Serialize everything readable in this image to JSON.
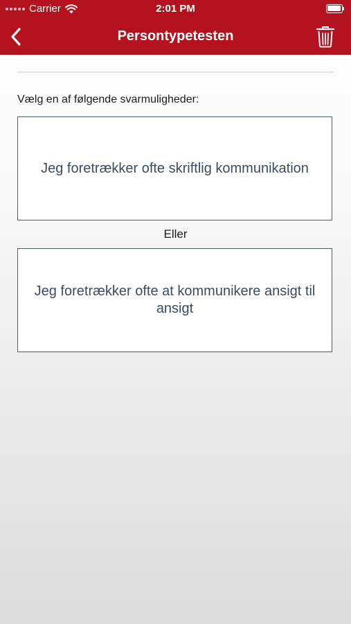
{
  "status_bar": {
    "carrier": "Carrier",
    "time": "2:01 PM"
  },
  "nav": {
    "title": "Persontypetesten",
    "back_icon": "chevron-left-icon",
    "trash_icon": "trash-icon"
  },
  "content": {
    "prompt": "Vælg en af følgende svarmuligheder:",
    "option_1": "Jeg foretrækker ofte skriftlig kommunikation",
    "or_label": "Eller",
    "option_2": "Jeg foretrækker ofte at kommunikere ansigt til ansigt"
  },
  "colors": {
    "header": "#b3121e",
    "option_text": "#3b4a62",
    "option_border": "#4a5a70"
  }
}
